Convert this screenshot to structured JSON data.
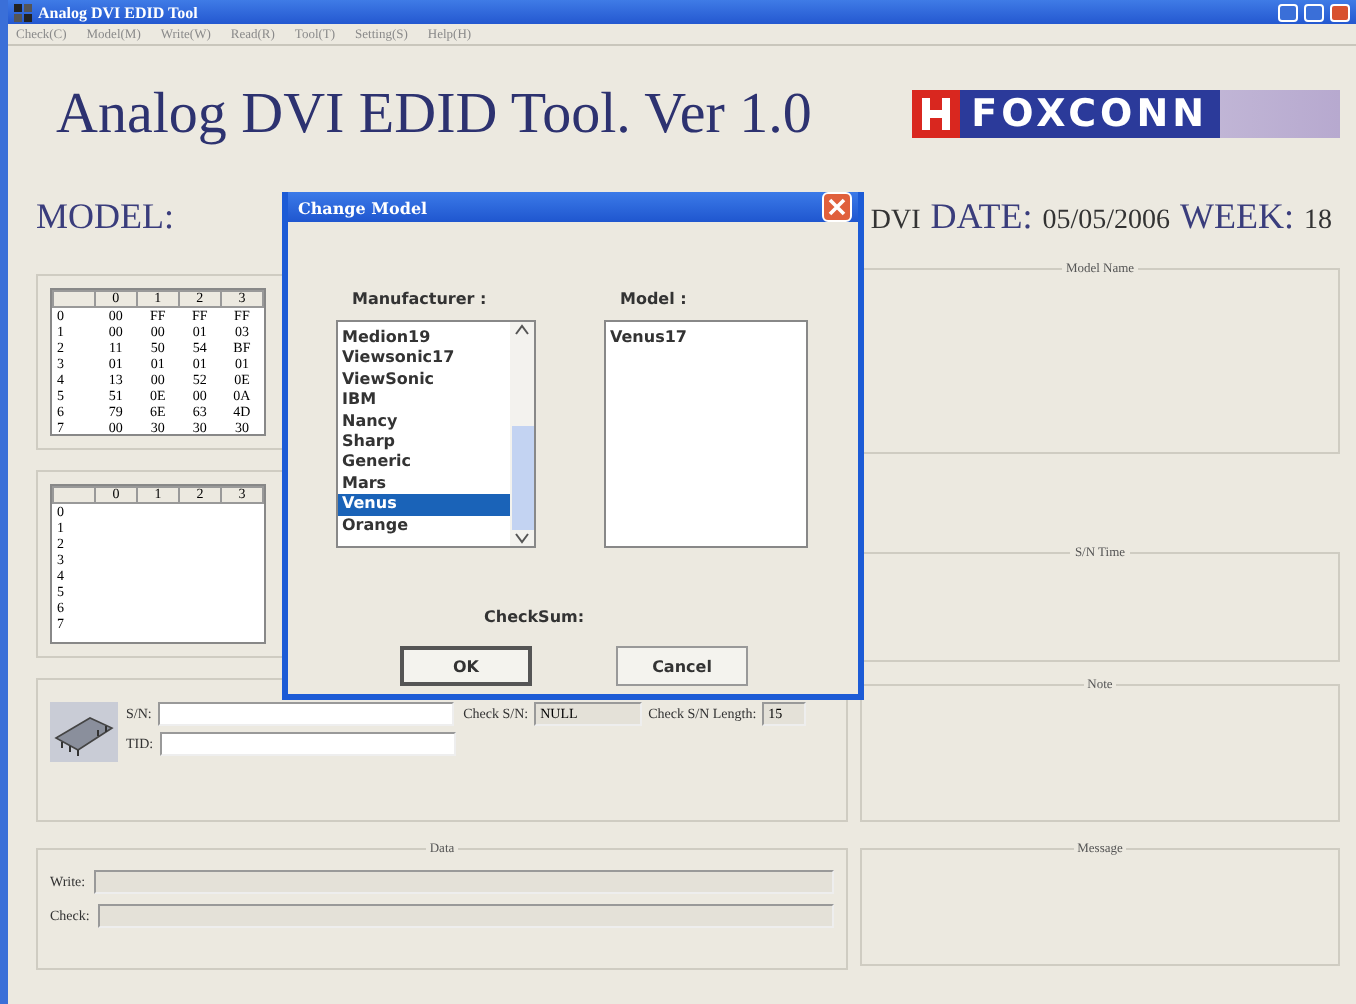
{
  "window": {
    "title": "Analog DVI EDID Tool",
    "menu": [
      "Check(C)",
      "Model(M)",
      "Write(W)",
      "Read(R)",
      "Tool(T)",
      "Setting(S)",
      "Help(H)"
    ]
  },
  "header": {
    "title": "Analog DVI EDID Tool. Ver 1.0",
    "logo": "FOXCONN"
  },
  "info": {
    "model_label": "MODEL:",
    "interface": "DVI",
    "date_label": "DATE:",
    "date": "05/05/2006",
    "week_label": "WEEK:",
    "week": "18"
  },
  "edid_table": {
    "columns": [
      "0",
      "1",
      "2",
      "3"
    ],
    "rows": [
      {
        "label": "0",
        "cells": [
          "00",
          "FF",
          "FF",
          "FF"
        ]
      },
      {
        "label": "1",
        "cells": [
          "00",
          "00",
          "01",
          "03"
        ]
      },
      {
        "label": "2",
        "cells": [
          "11",
          "50",
          "54",
          "BF"
        ]
      },
      {
        "label": "3",
        "cells": [
          "01",
          "01",
          "01",
          "01"
        ]
      },
      {
        "label": "4",
        "cells": [
          "13",
          "00",
          "52",
          "0E"
        ]
      },
      {
        "label": "5",
        "cells": [
          "51",
          "0E",
          "00",
          "0A"
        ]
      },
      {
        "label": "6",
        "cells": [
          "79",
          "6E",
          "63",
          "4D"
        ]
      },
      {
        "label": "7",
        "cells": [
          "00",
          "30",
          "30",
          "30"
        ]
      }
    ]
  },
  "edid_table_2": {
    "columns": [
      "0",
      "1",
      "2",
      "3"
    ],
    "row_labels": [
      "0",
      "1",
      "2",
      "3",
      "4",
      "5",
      "6",
      "7"
    ]
  },
  "serial": {
    "sn_label": "S/N:",
    "tid_label": "TID:",
    "check_sn_label": "Check S/N:",
    "check_sn": "NULL",
    "length_label": "Check S/N Length:",
    "length": "15"
  },
  "data_group": {
    "title": "Data",
    "write_label": "Write:",
    "check_label": "Check:"
  },
  "groups": [
    "Model Name",
    "S/N Time",
    "Note",
    "Message"
  ],
  "dialog": {
    "title": "Change Model",
    "manufacturer_label": "Manufacturer :",
    "model_label": "Model :",
    "manufacturers": [
      {
        "name": "Medion19",
        "selected": false
      },
      {
        "name": "Viewsonic17",
        "selected": false
      },
      {
        "name": "ViewSonic",
        "selected": false
      },
      {
        "name": "IBM",
        "selected": false
      },
      {
        "name": "Nancy",
        "selected": false
      },
      {
        "name": "Sharp",
        "selected": false
      },
      {
        "name": "Generic",
        "selected": false
      },
      {
        "name": "Mars",
        "selected": false
      },
      {
        "name": "Venus",
        "selected": true
      },
      {
        "name": "Orange",
        "selected": false
      }
    ],
    "models": [
      {
        "name": "Venus17",
        "selected": false
      }
    ],
    "checksum_label": "CheckSum:",
    "buttons": [
      {
        "label": "OK",
        "focused": true
      },
      {
        "label": "Cancel",
        "focused": false
      }
    ]
  }
}
